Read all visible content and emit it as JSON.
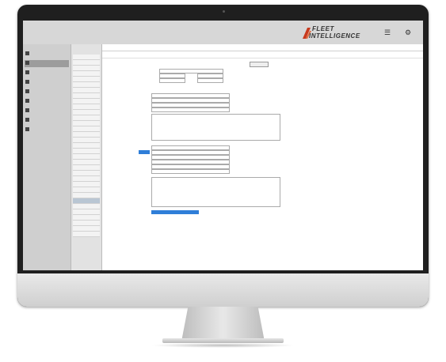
{
  "brand": {
    "logo_line1": "FLEET",
    "logo_line2": "INTELLIGENCE",
    "logo_sub": "",
    "accent_color": "#c83a1e"
  },
  "topbar_icons": [
    "menu-icon",
    "settings-icon"
  ],
  "sidebar": {
    "items": [
      {
        "label": "",
        "icon": "warning-icon",
        "active": false
      },
      {
        "label": "",
        "icon": "list-icon",
        "active": true
      },
      {
        "label": "",
        "icon": "truck-icon",
        "active": false
      },
      {
        "label": "",
        "icon": "gear-icon",
        "active": false
      },
      {
        "label": "",
        "icon": "wrench-icon",
        "active": false
      },
      {
        "label": "",
        "icon": "truck-icon",
        "active": false
      },
      {
        "label": "",
        "icon": "gear-icon",
        "active": false
      },
      {
        "label": "",
        "icon": "document-icon",
        "active": false
      },
      {
        "label": "",
        "icon": "chart-icon",
        "active": false
      }
    ]
  },
  "list_pane": {
    "title": "",
    "rows": [
      "",
      "",
      "",
      "",
      "",
      "",
      "",
      "",
      "",
      "",
      "",
      "",
      "",
      "",
      "",
      "",
      "",
      "",
      "",
      "",
      "",
      "",
      "",
      "",
      "",
      "",
      "",
      "",
      "",
      "",
      "",
      "",
      ""
    ],
    "selected_index": 26
  },
  "main": {
    "tabs": [],
    "toolbar": []
  }
}
